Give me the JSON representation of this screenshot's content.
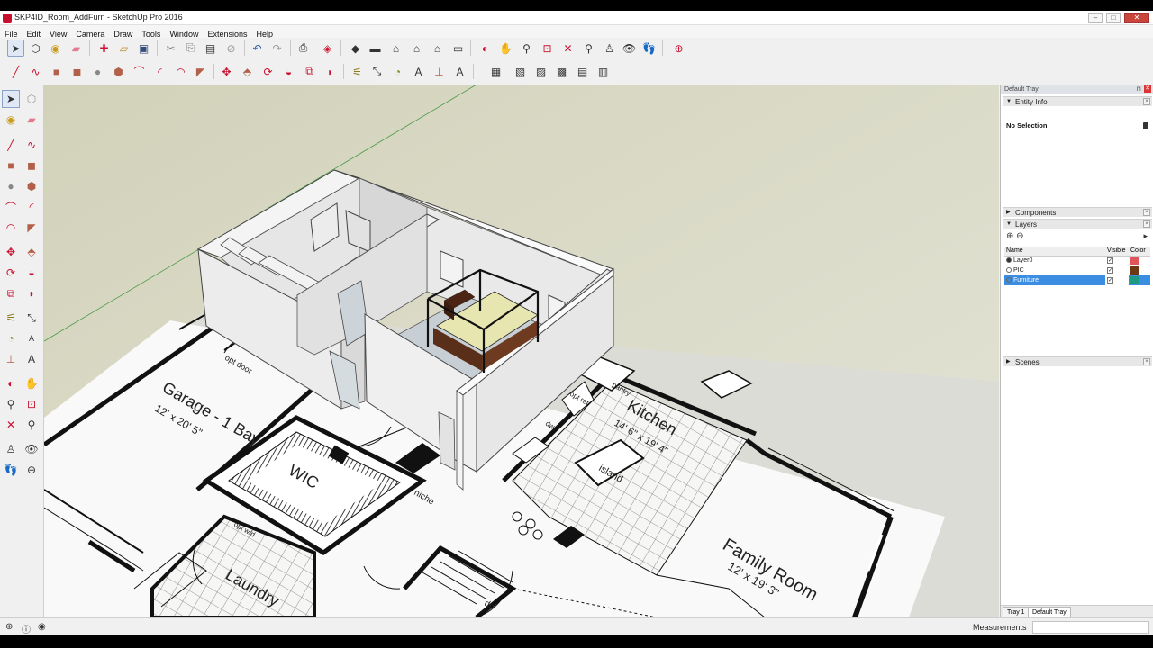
{
  "window": {
    "title": "SKP4ID_Room_AddFurn - SketchUp Pro 2016",
    "minimize": "–",
    "maximize": "□",
    "close": "✕"
  },
  "menu": [
    "File",
    "Edit",
    "View",
    "Camera",
    "Draw",
    "Tools",
    "Window",
    "Extensions",
    "Help"
  ],
  "plan_labels": {
    "garage": "Garage - 1 Bay",
    "garage_dims": "12' x 20' 5\"",
    "opt_door": "opt door",
    "wic": "WIC",
    "niche": "niche",
    "pantry": "pantry",
    "opt_ref": "opt ref",
    "dw": "dw",
    "kitchen": "Kitchen",
    "kitchen_dims": "14' 6\" x 19' 4\"",
    "island": "island",
    "family_room": "Family Room",
    "family_dims": "12' x 19' 3\"",
    "laundry": "Laundry",
    "dn": "dn",
    "opt_wd": "opt w/d"
  },
  "tray": {
    "title": "Default Tray",
    "entity_info": {
      "header": "Entity Info",
      "selection": "No Selection"
    },
    "components": {
      "header": "Components"
    },
    "layers": {
      "header": "Layers",
      "columns": [
        "Name",
        "Visible",
        "Color"
      ],
      "rows": [
        {
          "name": "Layer0",
          "visible": "✓",
          "color": "#e0545a",
          "current": true
        },
        {
          "name": "PIC",
          "visible": "✓",
          "color": "#6b3a14",
          "current": false
        },
        {
          "name": "Furniture",
          "visible": "✓",
          "color": "#1c9a84",
          "current": false
        }
      ]
    },
    "scenes": {
      "header": "Scenes"
    },
    "tabs": [
      "Tray 1",
      "Default Tray"
    ]
  },
  "status": {
    "measurements_label": "Measurements",
    "measurements_value": ""
  }
}
